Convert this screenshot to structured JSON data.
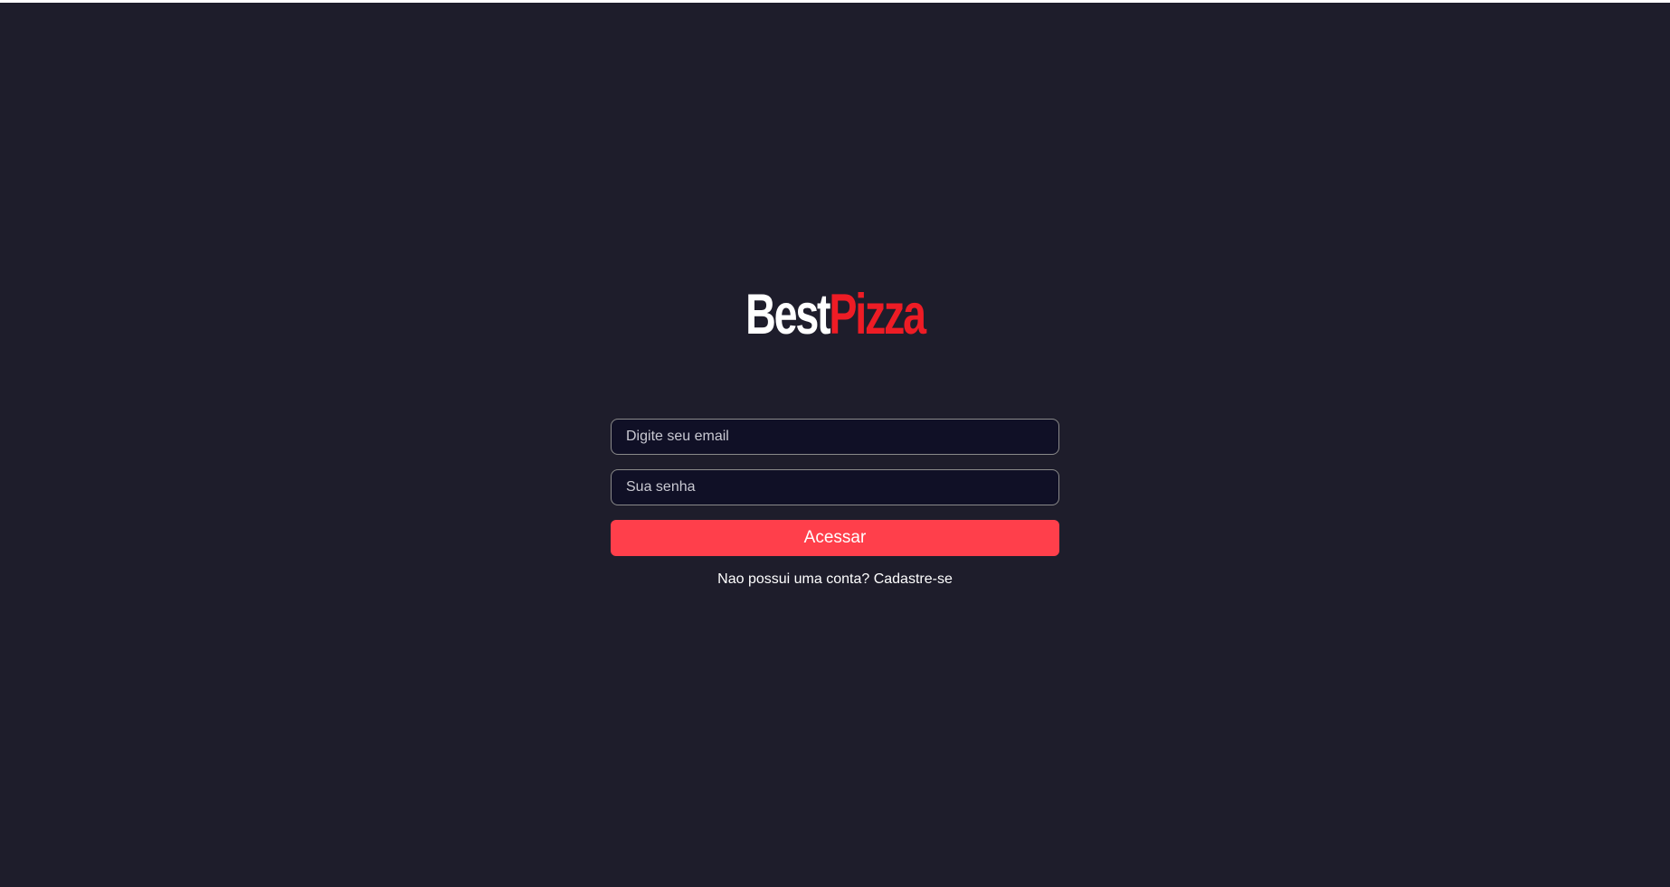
{
  "brand": {
    "logo_part1": "Best",
    "logo_part2": "Pizza",
    "colors": {
      "background": "#1e1d2b",
      "logo_primary": "#ffffff",
      "logo_accent": "#ee1c25",
      "button": "#ff3f4b",
      "input_background": "#101026"
    }
  },
  "login_form": {
    "email_placeholder": "Digite seu email",
    "email_value": "",
    "password_placeholder": "Sua senha",
    "password_value": "",
    "submit_label": "Acessar",
    "signup_link": "Nao possui uma conta? Cadastre-se"
  }
}
